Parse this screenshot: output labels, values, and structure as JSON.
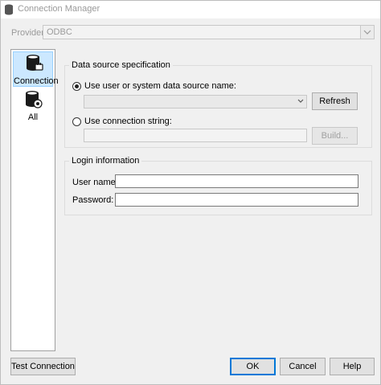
{
  "window": {
    "title": "Connection Manager"
  },
  "provider": {
    "label": "Provider:",
    "value": "ODBC"
  },
  "nav": {
    "items": [
      {
        "label": "Connection",
        "icon": "database-plug-icon",
        "selected": true
      },
      {
        "label": "All",
        "icon": "database-settings-icon",
        "selected": false
      }
    ]
  },
  "data_source": {
    "group_title": "Data source specification",
    "dsn_radio_label": "Use user or system data source name:",
    "dsn_selected": true,
    "dsn_value": "",
    "refresh_label": "Refresh",
    "conn_string_radio_label": "Use connection string:",
    "conn_string_value": "",
    "build_label": "Build..."
  },
  "login": {
    "group_title": "Login information",
    "username_label": "User name:",
    "username_value": "",
    "password_label": "Password:",
    "password_value": ""
  },
  "footer": {
    "test_label": "Test Connection",
    "ok_label": "OK",
    "cancel_label": "Cancel",
    "help_label": "Help"
  }
}
